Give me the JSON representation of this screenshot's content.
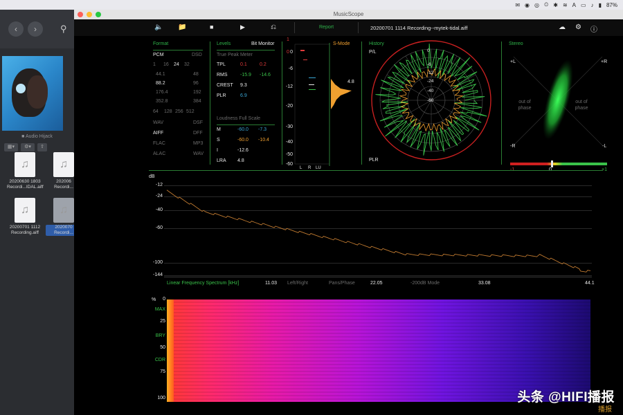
{
  "menubar": {
    "tray_icons": [
      "message-icon",
      "wechat-icon",
      "browser-icon",
      "history-icon",
      "bluetooth-icon",
      "wifi-icon",
      "keyboard-icon",
      "airplay-icon",
      "volume-icon",
      "battery-icon"
    ],
    "battery_pct": "87%"
  },
  "finder": {
    "folder": "Audio Hijack",
    "files": [
      {
        "name_l1": "20200630 1803",
        "name_l2": "Recordi...IDAL.aiff",
        "selected": false
      },
      {
        "name_l1": "202006",
        "name_l2": "Recordi...",
        "selected": false
      },
      {
        "name_l1": "20200701 1112",
        "name_l2": "Recording.aiff",
        "selected": false
      },
      {
        "name_l1": "2020070",
        "name_l2": "Recordi...",
        "selected": true
      }
    ]
  },
  "app": {
    "window_title": "MusicScope",
    "report_label": "Report",
    "file_name": "20200701 1114 Recording--mytek-tidal.aiff"
  },
  "format": {
    "title": "Format",
    "pcm": "PCM",
    "dsd": "DSD",
    "bits": [
      "1",
      "16",
      "24",
      "32"
    ],
    "rates": [
      [
        "44.1",
        "48"
      ],
      [
        "88.2",
        "96"
      ],
      [
        "176.4",
        "192"
      ],
      [
        "352.8",
        "384"
      ]
    ],
    "dsd_rates": [
      "64",
      "128",
      "256",
      "512"
    ],
    "types": [
      [
        "WAV",
        "DSF"
      ],
      [
        "AIFF",
        "DFF"
      ],
      [
        "FLAC",
        "MP3"
      ],
      [
        "ALAC",
        "WAV"
      ]
    ]
  },
  "levels": {
    "title": "Levels",
    "bit_monitor": "Bit Monitor",
    "tpm": "True Peak Meter",
    "rows": [
      {
        "label": "TPL",
        "l": "0.1",
        "r": "0.2",
        "color": "#e03a3a"
      },
      {
        "label": "RMS",
        "l": "-15.9",
        "r": "-14.6",
        "color": "#3ac24a"
      },
      {
        "label": "CREST",
        "l": "9.3",
        "r": "",
        "color": "#eaeaea"
      },
      {
        "label": "PLR",
        "l": "6.9",
        "r": "",
        "color": "#3aa6d4"
      }
    ],
    "loudness_title": "Loudness Full Scale",
    "loudness": [
      {
        "label": "M",
        "a": "-60.0",
        "b": "-7.3"
      },
      {
        "label": "S",
        "a": "-60.0",
        "b": "-10.4"
      },
      {
        "label": "I",
        "a": "-12.6",
        "b": ""
      },
      {
        "label": "LRA",
        "a": "4.8",
        "b": ""
      }
    ]
  },
  "meter": {
    "ticks": [
      "0",
      "-6",
      "-12",
      "-20",
      "-30",
      "-40",
      "-50",
      "-60"
    ],
    "top_marks": [
      "1",
      "0"
    ],
    "bottom_labels": [
      "L",
      "R",
      "LU"
    ],
    "smode_title": "S-Mode",
    "smode_value": "4.8"
  },
  "history": {
    "title": "History",
    "pl": "P/L",
    "plr": "PLR",
    "rings": [
      "0",
      "-6",
      "-12",
      "-24",
      "-40",
      "-60"
    ]
  },
  "stereo": {
    "title": "Stereo",
    "corner_labels": [
      "+L",
      "+R",
      "-R",
      "-L"
    ],
    "oop": "out of phase",
    "scale": [
      "-1",
      "0",
      "+1"
    ]
  },
  "spectrum": {
    "db_label": "dB",
    "y_ticks": [
      "-12",
      "-24",
      "-40",
      "-60",
      "-100",
      "-144"
    ],
    "x_title": "Linear Frequency Spectrum [kHz]",
    "x_ticks": [
      "11.03",
      "22.05",
      "33.08",
      "44.1"
    ],
    "modes": [
      "Left/Right",
      "Pans/Phase",
      "-200dB Mode"
    ]
  },
  "spectrogram": {
    "pct": "%",
    "labels": [
      {
        "t": "0",
        "c": "#eaeaea"
      },
      {
        "t": "MAX",
        "c": "#3ac24a"
      },
      {
        "t": "25",
        "c": "#eaeaea"
      },
      {
        "t": "BRY",
        "c": "#3ac24a"
      },
      {
        "t": "50",
        "c": "#eaeaea"
      },
      {
        "t": "CDR",
        "c": "#3ac24a"
      },
      {
        "t": "75",
        "c": "#eaeaea"
      },
      {
        "t": "100",
        "c": "#eaeaea"
      }
    ]
  },
  "watermark": {
    "text": "头条 @HIFI播报",
    "site": "播报"
  }
}
